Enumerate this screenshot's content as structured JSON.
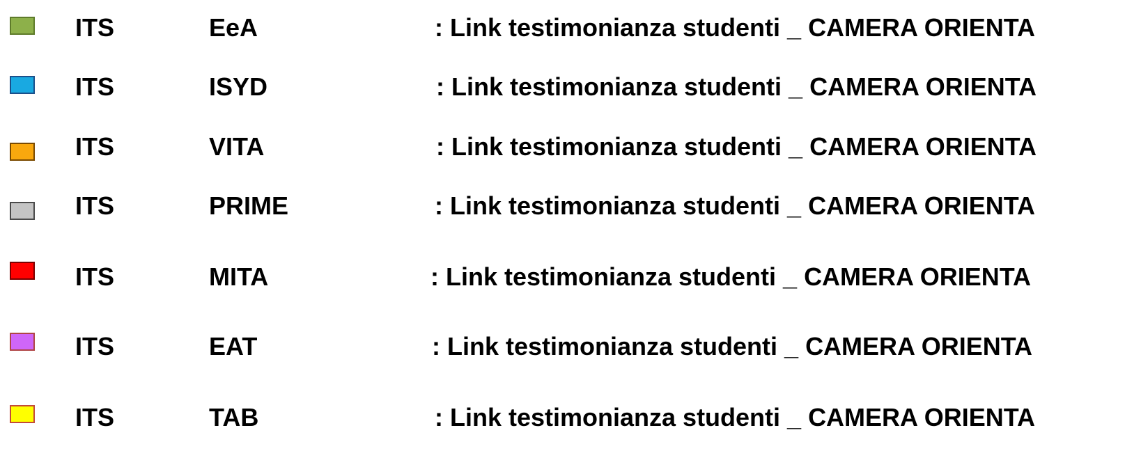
{
  "rows": [
    {
      "prefix": "ITS",
      "code": "EeA",
      "link_text": ": Link testimonianza studenti _ CAMERA ORIENTA",
      "color": "#8DB04A",
      "border": "#5E7B2A"
    },
    {
      "prefix": "ITS",
      "code": "ISYD",
      "link_text": ": Link testimonianza studenti _ CAMERA ORIENTA",
      "color": "#19A9E1",
      "border": "#1B4F8A"
    },
    {
      "prefix": "ITS",
      "code": "VITA",
      "link_text": ": Link testimonianza studenti _ CAMERA ORIENTA",
      "color": "#F9A80E",
      "border": "#7A4A00"
    },
    {
      "prefix": "ITS",
      "code": "PRIME",
      "link_text": ": Link testimonianza studenti _ CAMERA ORIENTA",
      "color": "#C4C4C4",
      "border": "#4A4A4A"
    },
    {
      "prefix": "ITS",
      "code": "MITA",
      "link_text": ": Link testimonianza studenti _ CAMERA ORIENTA",
      "color": "#FF0000",
      "border": "#7A0000"
    },
    {
      "prefix": "ITS",
      "code": "EAT",
      "link_text": ": Link testimonianza studenti _ CAMERA ORIENTA",
      "color": "#CF66F8",
      "border": "#B04545"
    },
    {
      "prefix": "ITS",
      "code": "TAB",
      "link_text": ": Link testimonianza studenti _ CAMERA ORIENTA",
      "color": "#FFFF00",
      "border": "#C24A3A"
    }
  ]
}
